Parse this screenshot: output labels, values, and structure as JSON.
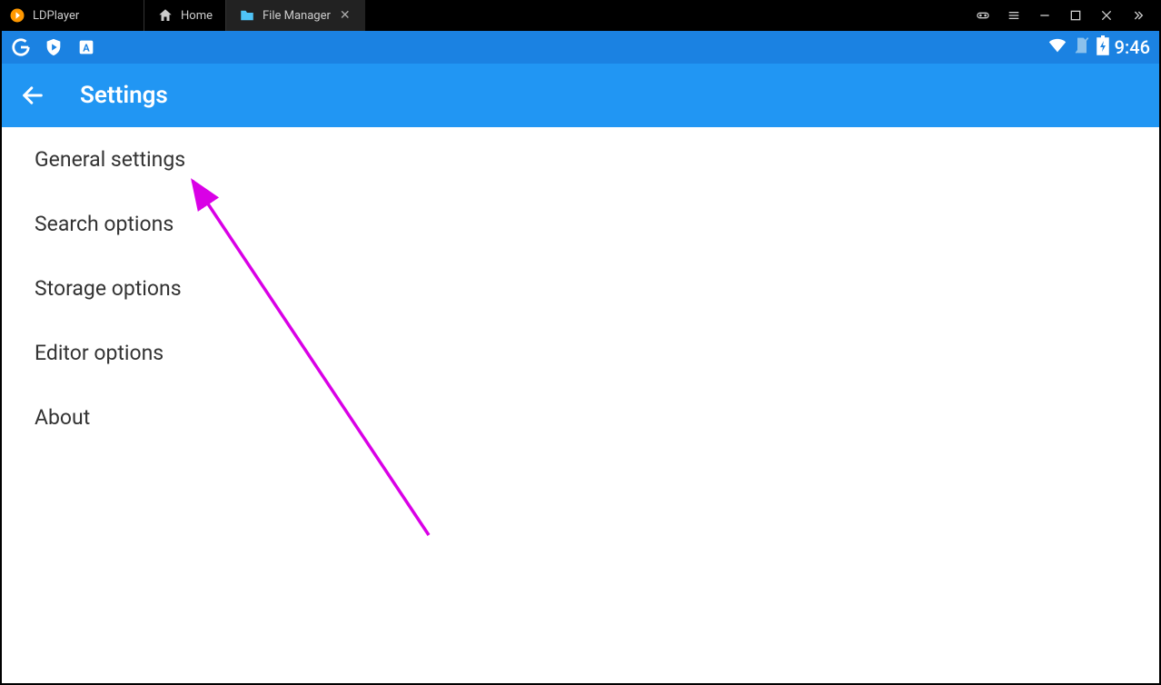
{
  "titlebar": {
    "app_name": "LDPlayer",
    "tabs": [
      {
        "label": "Home",
        "active": false,
        "icon": "home-icon"
      },
      {
        "label": "File Manager",
        "active": true,
        "icon": "folder-icon"
      }
    ]
  },
  "statusbar": {
    "time": "9:46"
  },
  "appbar": {
    "title": "Settings"
  },
  "settings_items": [
    "General settings",
    "Search options",
    "Storage options",
    "Editor options",
    "About"
  ],
  "annotation": {
    "arrow_color": "#d900e6"
  }
}
